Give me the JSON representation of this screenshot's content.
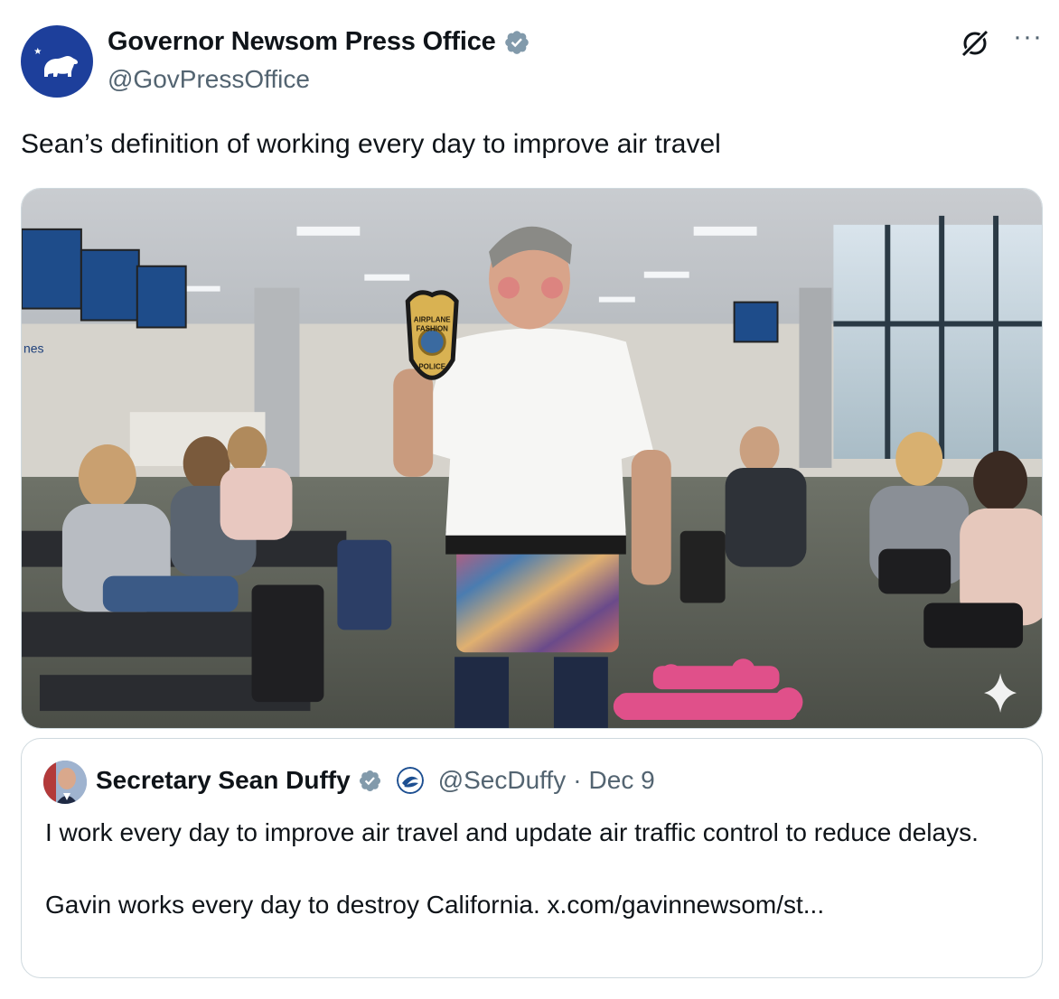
{
  "author": {
    "display_name": "Governor Newsom Press Office",
    "handle": "@GovPressOffice",
    "avatar_icon": "california-bear-icon",
    "verified_icon": "verified-badge-icon"
  },
  "actions": {
    "grok_icon": "grok-icon",
    "more_label": "···"
  },
  "tweet": {
    "text": "Sean’s definition of working every day to improve air travel"
  },
  "media": {
    "badge_lines": [
      "AIRPLANE",
      "FASHION",
      "POLICE"
    ],
    "sign_text": "nes",
    "sparkle_icon": "sparkle-icon"
  },
  "quote": {
    "display_name": "Secretary Sean Duffy",
    "handle": "@SecDuffy",
    "separator": "·",
    "date": "Dec 9",
    "line1": "I work every day to improve air travel and update air traffic control to reduce delays.",
    "line2": "Gavin works every day to destroy California. x.com/gavinnewsom/st..."
  },
  "colors": {
    "brand_blue": "#1d3f9b",
    "verified_blue": "#829aab",
    "secondary_text": "#536471",
    "border": "#cfd9de"
  }
}
